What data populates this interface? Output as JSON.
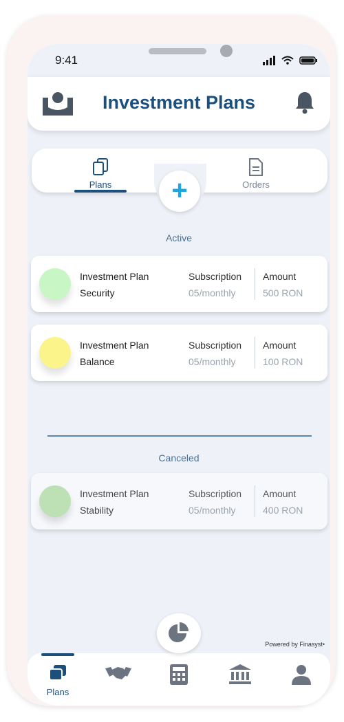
{
  "status_bar": {
    "time": "9:41"
  },
  "header": {
    "title": "Investment Plans",
    "logo_icon": "brand-logo-icon",
    "bell_icon": "bell-icon"
  },
  "tabs": [
    {
      "label": "Plans",
      "icon": "documents-icon",
      "active": true
    },
    {
      "label": "Orders",
      "icon": "document-icon",
      "active": false
    }
  ],
  "add_button": {
    "symbol": "+"
  },
  "sections": {
    "active": "Active",
    "canceled": "Canceled"
  },
  "plans_active": [
    {
      "name_line1": "Investment Plan",
      "name_line2": "Security",
      "subscription_label": "Subscription",
      "subscription_value": "05/monthly",
      "amount_label": "Amount",
      "amount_value": "500 RON",
      "color": "#c8f7c5"
    },
    {
      "name_line1": "Investment Plan",
      "name_line2": "Balance",
      "subscription_label": "Subscription",
      "subscription_value": "05/monthly",
      "amount_label": "Amount",
      "amount_value": "100 RON",
      "color": "#fbf48a"
    }
  ],
  "plans_canceled": [
    {
      "name_line1": "Investment Plan",
      "name_line2": "Stability",
      "subscription_label": "Subscription",
      "subscription_value": "05/monthly",
      "amount_label": "Amount",
      "amount_value": "400 RON",
      "color": "#bde0b4"
    }
  ],
  "powered_by": "Powered by Finasyst",
  "bottom_nav": [
    {
      "label": "Plans",
      "icon": "plans-icon",
      "active": true
    },
    {
      "label": "",
      "icon": "handshake-icon",
      "active": false
    },
    {
      "label": "",
      "icon": "calculator-icon",
      "active": false
    },
    {
      "label": "",
      "icon": "bank-icon",
      "active": false
    },
    {
      "label": "",
      "icon": "user-icon",
      "active": false
    }
  ],
  "fab_icon": "pie-chart-icon",
  "colors": {
    "primary": "#1b4f7e",
    "accent": "#1ca7e2",
    "background": "#eef2f8"
  }
}
